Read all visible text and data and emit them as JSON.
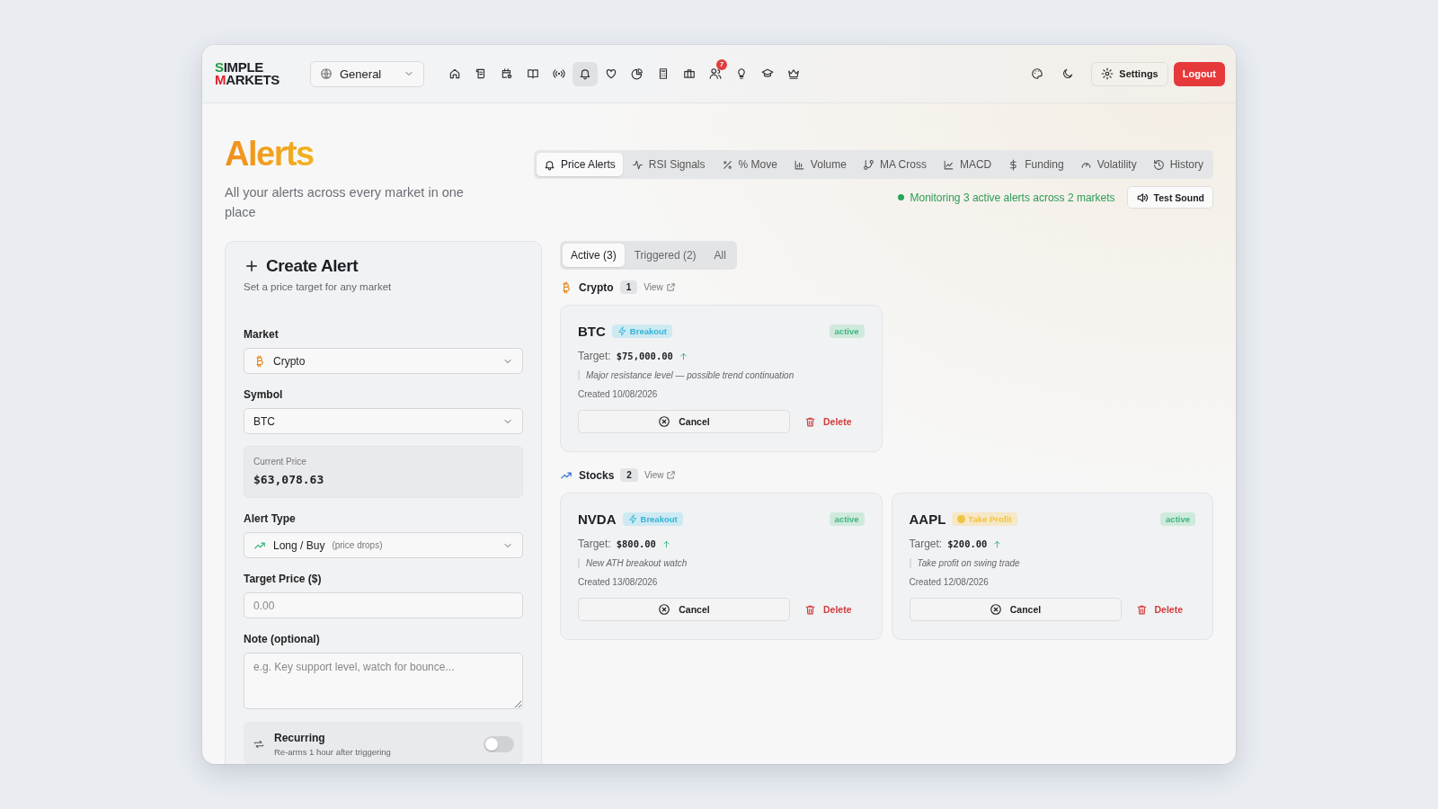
{
  "logo": {
    "lines": [
      "SIMPLE",
      "MARKETS"
    ]
  },
  "workspace": {
    "value": "General"
  },
  "nav_icons": [
    {
      "selected": false
    },
    {
      "selected": false
    },
    {
      "selected": false
    },
    {
      "selected": false
    },
    {
      "selected": false
    },
    {
      "selected": true
    },
    {
      "selected": false
    },
    {
      "selected": false
    },
    {
      "selected": false
    },
    {
      "selected": false
    },
    {
      "selected": false,
      "badge": "7"
    },
    {
      "selected": false
    },
    {
      "selected": false
    },
    {
      "selected": false
    }
  ],
  "header_actions": {
    "settings": "Settings",
    "logout": "Logout"
  },
  "page": {
    "title": "Alerts",
    "subtitle": "All your alerts across every market in one place"
  },
  "tabs": [
    {
      "label": "Price Alerts",
      "selected": true
    },
    {
      "label": "RSI Signals",
      "selected": false
    },
    {
      "label": "% Move",
      "selected": false
    },
    {
      "label": "Volume",
      "selected": false
    },
    {
      "label": "MA Cross",
      "selected": false
    },
    {
      "label": "MACD",
      "selected": false
    },
    {
      "label": "Funding",
      "selected": false
    },
    {
      "label": "Volatility",
      "selected": false
    },
    {
      "label": "History",
      "selected": false
    }
  ],
  "status": {
    "text": "Monitoring 3 active alerts across 2 markets",
    "button": "Test Sound"
  },
  "create_form": {
    "title": "Create Alert",
    "subtitle": "Set a price target for any market",
    "market": {
      "label": "Market",
      "value": "Crypto"
    },
    "symbol": {
      "label": "Symbol",
      "value": "BTC"
    },
    "current_price": {
      "label": "Current Price",
      "value": "$63,078.63"
    },
    "alert_type": {
      "label": "Alert Type",
      "value": "Long / Buy",
      "hint": "(price drops)"
    },
    "target_price": {
      "label": "Target Price ($)",
      "placeholder": "0.00"
    },
    "note": {
      "label": "Note (optional)",
      "placeholder": "e.g. Key support level, watch for bounce..."
    },
    "recurring": {
      "label": "Recurring",
      "hint": "Re-arms 1 hour after triggering",
      "on": false
    }
  },
  "filters": [
    {
      "label": "Active (3)",
      "selected": true
    },
    {
      "label": "Triggered (2)",
      "selected": false
    },
    {
      "label": "All",
      "selected": false
    }
  ],
  "groups": [
    {
      "kind": "crypto",
      "name": "Crypto",
      "count": "1",
      "link": "View",
      "alerts": [
        {
          "symbol": "BTC",
          "strategy": {
            "kind": "breakout",
            "label": "Breakout"
          },
          "status": "active",
          "target_label": "Target:",
          "target": "$75,000.00",
          "note": "Major resistance level — possible trend continuation",
          "created": "Created 10/08/2026",
          "cancel": "Cancel",
          "delete": "Delete"
        }
      ]
    },
    {
      "kind": "stocks",
      "name": "Stocks",
      "count": "2",
      "link": "View",
      "alerts": [
        {
          "symbol": "NVDA",
          "strategy": {
            "kind": "breakout",
            "label": "Breakout"
          },
          "status": "active",
          "target_label": "Target:",
          "target": "$800.00",
          "note": "New ATH breakout watch",
          "created": "Created 13/08/2026",
          "cancel": "Cancel",
          "delete": "Delete"
        },
        {
          "symbol": "AAPL",
          "strategy": {
            "kind": "take_profit",
            "label": "Take Profit"
          },
          "status": "active",
          "target_label": "Target:",
          "target": "$200.00",
          "note": "Take profit on swing trade",
          "created": "Created 12/08/2026",
          "cancel": "Cancel",
          "delete": "Delete"
        }
      ]
    }
  ]
}
